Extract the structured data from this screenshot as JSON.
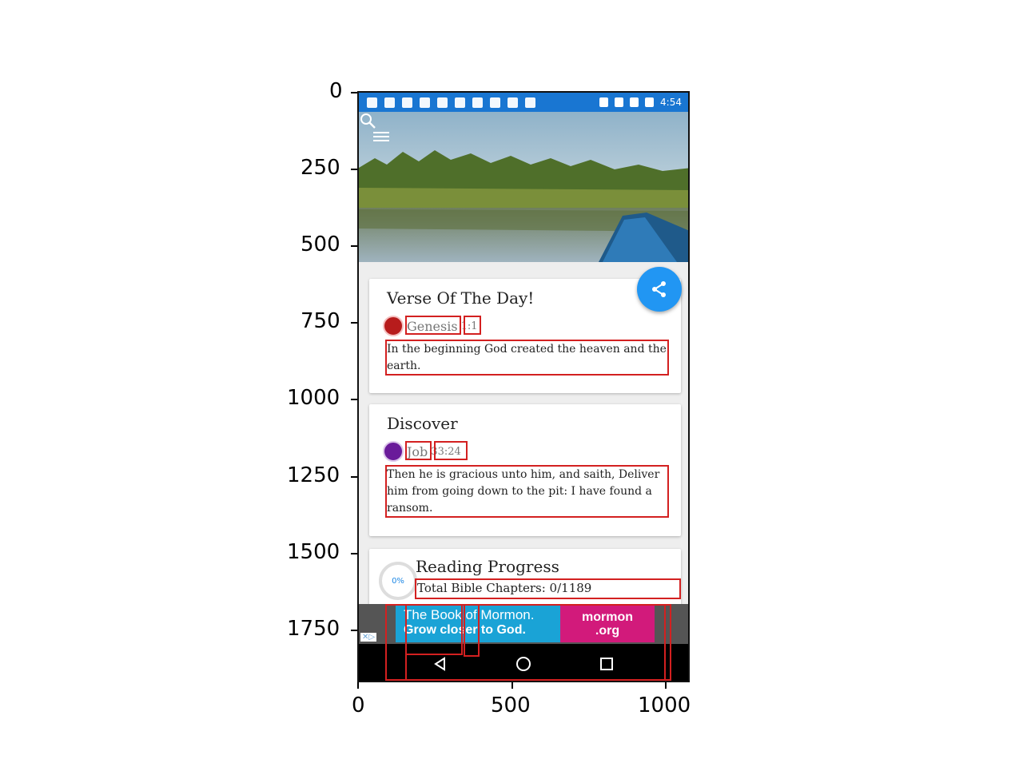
{
  "axes": {
    "y_ticks": [
      "0",
      "250",
      "500",
      "750",
      "1000",
      "1250",
      "1500",
      "1750"
    ],
    "x_ticks": [
      "0",
      "500",
      "1000"
    ]
  },
  "statusbar": {
    "time": "4:54"
  },
  "header": {
    "menu_icon": "hamburger-menu-icon",
    "search_icon": "search-icon"
  },
  "fab": {
    "icon": "share-icon",
    "color": "#2196f3"
  },
  "verse_of_day": {
    "title": "Verse Of The Day!",
    "book": "Genesis",
    "chapter_verse": "1:1",
    "text": "In the beginning God created the heaven and the earth."
  },
  "discover": {
    "title": "Discover",
    "book": "Job",
    "chapter_verse": "33:24",
    "text": "Then he is gracious unto him, and saith, Deliver him from going down to the pit: I have found a ransom."
  },
  "reading_progress": {
    "title": "Reading Progress",
    "percent": "0%",
    "total": "Total Bible Chapters: 0/1189"
  },
  "ad": {
    "line1": "The Book of Mormon.",
    "line2": "Grow closer to God.",
    "brand_line1": "mormon",
    "brand_line2": ".org"
  },
  "colors": {
    "statusbar": "#1976d2",
    "ad_blue": "#1aa3d6",
    "ad_pink": "#d21a7b",
    "annotation": "#d32020"
  }
}
